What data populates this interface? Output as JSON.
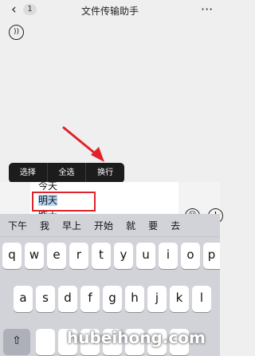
{
  "header": {
    "back_icon": "chevron-left-icon",
    "unread_count": "1",
    "title": "文件传输助手",
    "more_icon": "more-dots-icon"
  },
  "context_menu": {
    "items": [
      "选择",
      "全选",
      "换行"
    ]
  },
  "input": {
    "lines": [
      "今天",
      "明天",
      "昨天"
    ],
    "voice_icon": "voice-icon",
    "emoji_icon": "emoji-icon",
    "plus_icon": "plus-icon"
  },
  "keyboard": {
    "candidates": [
      "下午",
      "我",
      "早上",
      "开始",
      "就",
      "要",
      "去"
    ],
    "row1": [
      "q",
      "w",
      "e",
      "r",
      "t",
      "y",
      "u",
      "i",
      "o",
      "p"
    ],
    "row2": [
      "a",
      "s",
      "d",
      "f",
      "g",
      "h",
      "j",
      "k",
      "l"
    ],
    "shift_icon": "shift-icon"
  },
  "watermark": "hubeihong.com",
  "colors": {
    "highlight_box": "#e0222b",
    "arrow": "#e0222b",
    "menu_bg": "#1c1c1c",
    "keyboard_bg": "#d1d3d9"
  }
}
